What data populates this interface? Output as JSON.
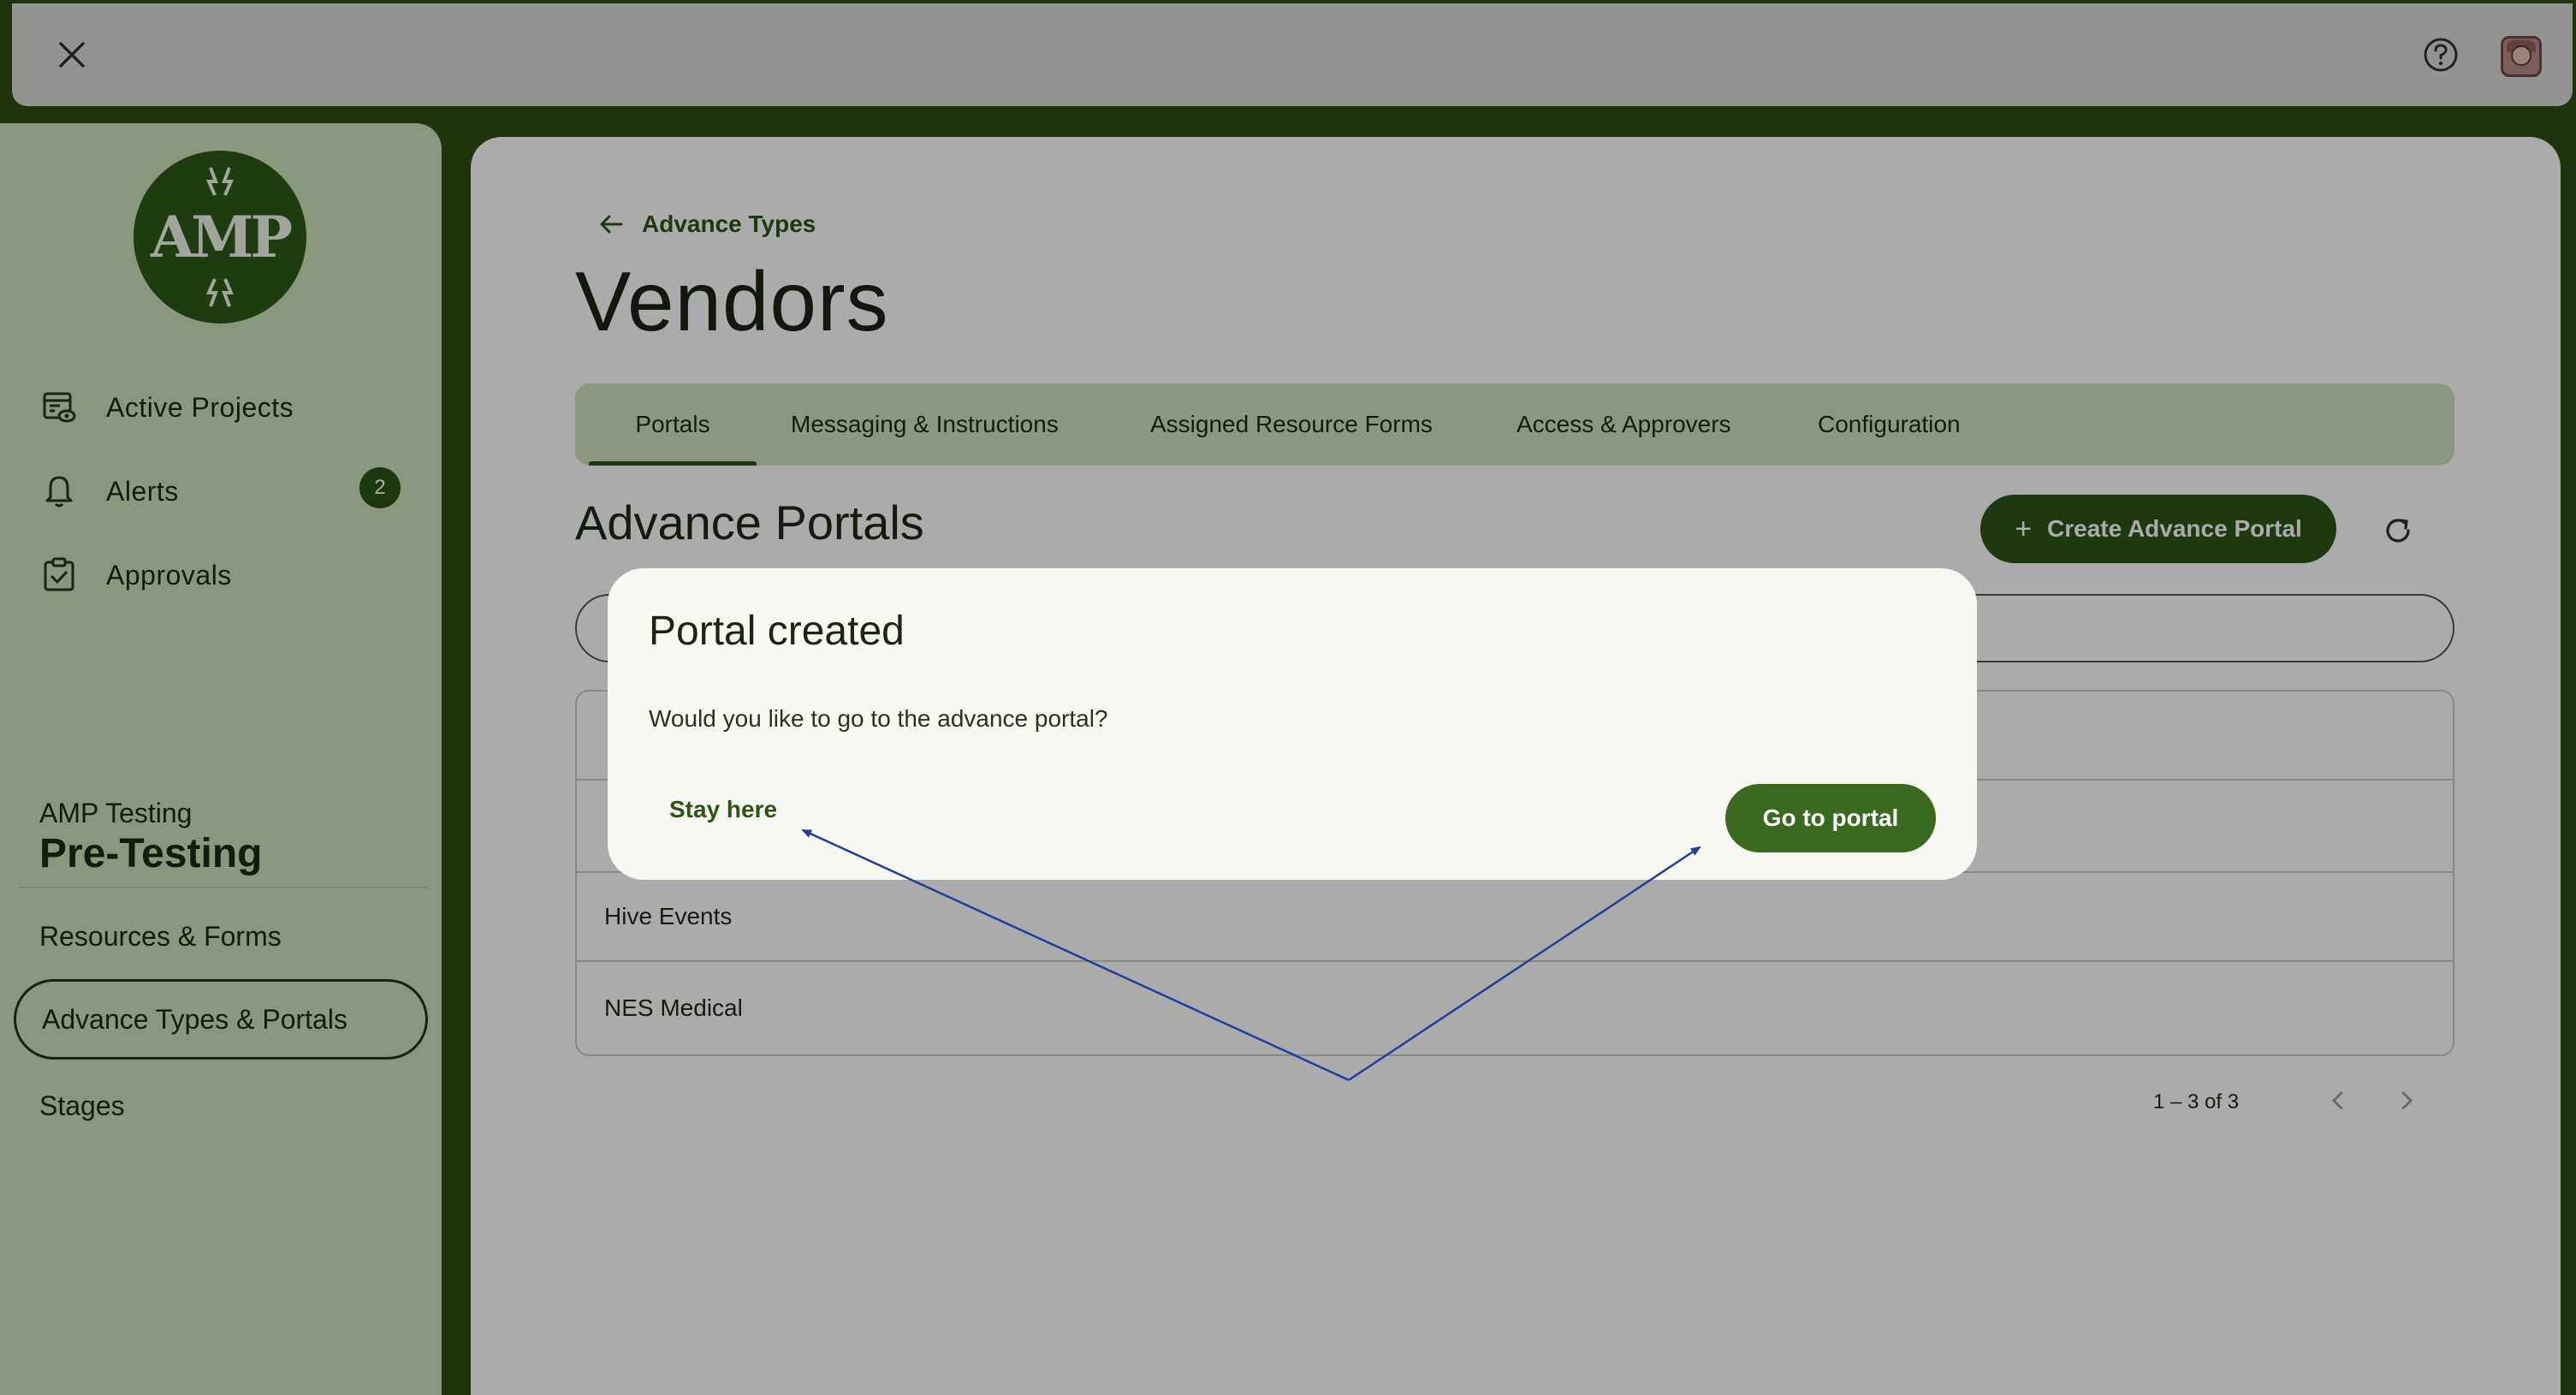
{
  "topbar": {
    "close_icon": "close-icon",
    "help_icon": "help-circle-icon",
    "avatar_icon": "user-avatar"
  },
  "sidebar": {
    "logo_text": "AMP",
    "nav": [
      {
        "label": "Active Projects",
        "icon": "projects-icon"
      },
      {
        "label": "Alerts",
        "icon": "bell-icon",
        "badge": "2"
      },
      {
        "label": "Approvals",
        "icon": "clipboard-check-icon"
      }
    ],
    "org_label": "AMP Testing",
    "org_name": "Pre-Testing",
    "links": [
      {
        "label": "Resources & Forms"
      },
      {
        "label": "Advance Types & Portals",
        "active": true
      },
      {
        "label": "Stages"
      }
    ]
  },
  "main": {
    "back_label": "Advance Types",
    "title": "Vendors",
    "tabs": [
      {
        "label": "Portals",
        "active": true
      },
      {
        "label": "Messaging & Instructions"
      },
      {
        "label": "Assigned Resource Forms"
      },
      {
        "label": "Access & Approvers"
      },
      {
        "label": "Configuration"
      }
    ],
    "section_title": "Advance Portals",
    "create_button": "Create Advance Portal",
    "portals": [
      "",
      "",
      "Hive Events",
      "NES Medical"
    ],
    "pagination": "1 – 3 of 3"
  },
  "dialog": {
    "title": "Portal created",
    "message": "Would you like to go to the advance portal?",
    "stay_label": "Stay here",
    "go_label": "Go to portal"
  },
  "colors": {
    "brand_green": "#2e5417",
    "sidebar_bg": "#cde1bd",
    "annotation_arrow": "#1f3fa0"
  }
}
